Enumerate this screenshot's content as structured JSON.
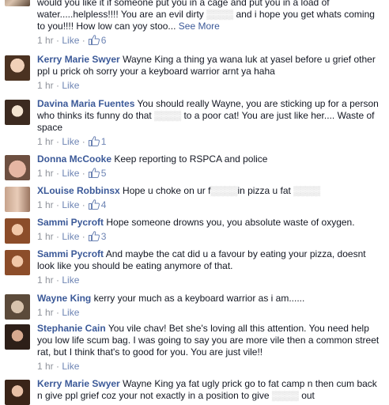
{
  "comments": [
    {
      "author": "",
      "text": "would you like it if someone put you in a cage and put you in a load of water.....helpless!!!! You are an evil dirty ",
      "text_redacted": "▒▒▒▒",
      "text_after": " and i hope you get whats coming to you!!!! How low can yoy stoo...",
      "see_more": "See More",
      "time": "1 hr",
      "like": "Like",
      "likes": "6"
    },
    {
      "author": "Kerry Marie Swyer",
      "text": "Wayne King a thing ya wana luk at yasel before u grief other ppl u prick oh sorry your a keyboard warrior arnt ya haha",
      "time": "1 hr",
      "like": "Like",
      "likes": ""
    },
    {
      "author": "Davina Maria Fuentes",
      "text": "You should really Wayne, you are sticking up for a person who thinks its funny do that ",
      "text_redacted": "▒▒▒▒",
      "text_after": " to a poor cat! You are just like her.... Waste of space",
      "time": "1 hr",
      "like": "Like",
      "likes": "1"
    },
    {
      "author": "Donna McCooke",
      "text": "Keep reporting to RSPCA and police",
      "time": "1 hr",
      "like": "Like",
      "likes": "5"
    },
    {
      "author": "XLouise Robbinsx",
      "text": "Hope u choke on ur f",
      "text_redacted": "▒▒▒▒",
      "text_after": "in pizza u fat ",
      "text_redacted2": "▒▒▒▒",
      "time": "1 hr",
      "like": "Like",
      "likes": "4"
    },
    {
      "author": "Sammi Pycroft",
      "text": "Hope someone drowns you, you absolute waste of oxygen.",
      "time": "1 hr",
      "like": "Like",
      "likes": "3"
    },
    {
      "author": "Sammi Pycroft",
      "text": "And maybe the cat did u a favour by eating your pizza, doesnt look like you should be eating anymore of that.",
      "time": "1 hr",
      "like": "Like",
      "likes": ""
    },
    {
      "author": "Wayne King",
      "text": "kerry your much as a keyboard warrior as i am......",
      "time": "1 hr",
      "like": "Like",
      "likes": ""
    },
    {
      "author": "Stephanie Cain",
      "text": "You vile chav! Bet she's loving all this attention. You need help you low life scum bag. I was going to say you are more vile then a common street rat, but I think that's to good for you. You are just vile!!",
      "time": "1 hr",
      "like": "Like",
      "likes": ""
    },
    {
      "author": "Kerry Marie Swyer",
      "text": "Wayne King ya fat ugly prick go to fat camp n then cum back n give ppl grief coz your not exactly in a position to give ",
      "text_redacted": "▒▒▒▒",
      "text_after": " out",
      "time": "",
      "like": "",
      "likes": ""
    }
  ],
  "colors": {
    "author": "#3b5998",
    "text": "#141823",
    "meta": "#90949c",
    "like": "#6d84b4"
  },
  "icons": {
    "like_count": "thumbs-up-icon"
  }
}
